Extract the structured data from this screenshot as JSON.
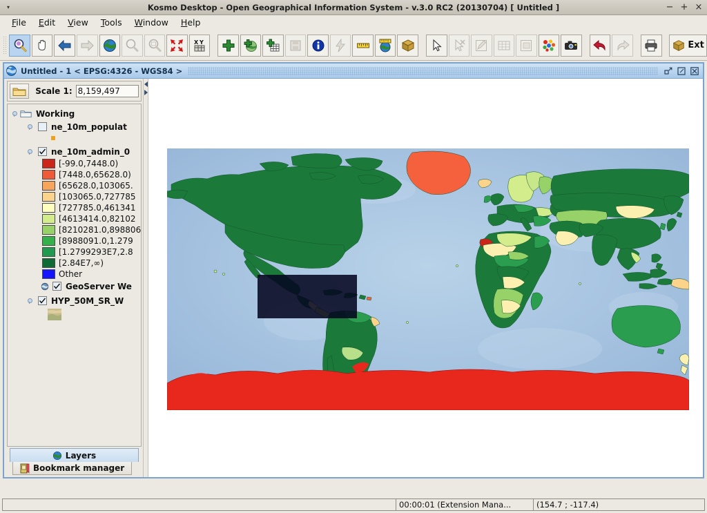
{
  "window": {
    "title": "Kosmo Desktop - Open Geographical Information System - v.3.0 RC2 (20130704)  [ Untitled ]",
    "minimize": "−",
    "maximize": "+",
    "close": "×",
    "menu_dot": "▾"
  },
  "menubar": {
    "items": [
      {
        "label": "File",
        "mnemonic": "F"
      },
      {
        "label": "Edit",
        "mnemonic": "E"
      },
      {
        "label": "View",
        "mnemonic": "V"
      },
      {
        "label": "Tools",
        "mnemonic": "T"
      },
      {
        "label": "Window",
        "mnemonic": "W"
      },
      {
        "label": "Help",
        "mnemonic": "H"
      }
    ]
  },
  "toolbar": {
    "buttons": [
      {
        "name": "zoom-in-tool-icon",
        "state": "selected"
      },
      {
        "name": "pan-hand-icon",
        "state": "normal"
      },
      {
        "name": "back-arrow-icon",
        "state": "normal"
      },
      {
        "name": "forward-arrow-icon",
        "state": "disabled"
      },
      {
        "name": "zoom-full-extent-globe-icon",
        "state": "normal"
      },
      {
        "name": "zoom-out-icon",
        "state": "disabled"
      },
      {
        "name": "zoom-selected-icon",
        "state": "disabled"
      },
      {
        "name": "zoom-to-selection-icon",
        "state": "normal"
      },
      {
        "name": "goto-xy-icon",
        "state": "normal"
      },
      {
        "name": "add-layer-icon",
        "state": "normal"
      },
      {
        "name": "add-wms-layer-icon",
        "state": "normal"
      },
      {
        "name": "add-table-layer-icon",
        "state": "normal"
      },
      {
        "name": "save-layer-icon",
        "state": "disabled"
      },
      {
        "name": "info-tool-icon",
        "state": "normal"
      },
      {
        "name": "quick-query-icon",
        "state": "disabled"
      },
      {
        "name": "measure-distance-icon",
        "state": "normal"
      },
      {
        "name": "measure-geodesic-icon",
        "state": "normal"
      },
      {
        "name": "package-3d-icon",
        "state": "normal"
      },
      {
        "name": "select-pointer-icon",
        "state": "normal"
      },
      {
        "name": "deselect-pointer-icon",
        "state": "disabled"
      },
      {
        "name": "edit-geometry-icon",
        "state": "disabled"
      },
      {
        "name": "attribute-table-icon",
        "state": "disabled"
      },
      {
        "name": "copy-layer-icon",
        "state": "disabled"
      },
      {
        "name": "symbology-icon",
        "state": "normal"
      },
      {
        "name": "snapshot-camera-icon",
        "state": "normal"
      },
      {
        "name": "undo-icon",
        "state": "normal"
      },
      {
        "name": "redo-icon",
        "state": "disabled"
      },
      {
        "name": "print-icon",
        "state": "normal"
      }
    ],
    "extension_button": {
      "label": "Ext",
      "icon": "package-3d-icon"
    }
  },
  "mapframe": {
    "title": "Untitled - 1 < EPSG:4326 - WGS84 >",
    "restore": "▫",
    "maximize": "◱",
    "close": "⌧"
  },
  "panel": {
    "folder_button_icon": "folder-icon",
    "scale_label": "Scale 1:",
    "scale_value": "8,159,497",
    "tabs": [
      {
        "label": "Layers",
        "icon": "globe-icon",
        "active": true
      },
      {
        "label": "Bookmark manager",
        "icon": "bookmark-icon",
        "active": false
      }
    ]
  },
  "tree": {
    "root": {
      "label": "Working",
      "icon": "folder-icon"
    },
    "layers": [
      {
        "label": "ne_10m_populat",
        "checked": false,
        "icon": null,
        "legend": [
          {
            "label": "",
            "color": "#f0a020",
            "shape": "dot"
          }
        ]
      },
      {
        "label": "ne_10m_admin_0",
        "checked": true,
        "icon": null,
        "legend": [
          {
            "label": "[-99.0,7448.0)",
            "color": "#cc2418"
          },
          {
            "label": "[7448.0,65628.0)",
            "color": "#ef5b38"
          },
          {
            "label": "[65628.0,103065.",
            "color": "#f8a55c"
          },
          {
            "label": "[103065.0,727785",
            "color": "#fbd38b"
          },
          {
            "label": "[727785.0,461341",
            "color": "#ffffbe"
          },
          {
            "label": "[4613414.0,82102",
            "color": "#d3ec8c"
          },
          {
            "label": "[8210281.0,898806",
            "color": "#96d268"
          },
          {
            "label": "[8988091.0,1.279",
            "color": "#34b14a"
          },
          {
            "label": "[1.2799293E7,2.8",
            "color": "#1f9a4e"
          },
          {
            "label": "[2.84E7,∞)",
            "color": "#0d6b33"
          },
          {
            "label": "Other",
            "color": "#1313ff"
          }
        ]
      },
      {
        "label": "GeoServer We",
        "checked": true,
        "icon": "wms-globe-icon",
        "legend": []
      },
      {
        "label": "HYP_50M_SR_W",
        "checked": true,
        "icon": null,
        "legend": [
          {
            "label": "",
            "color": "#c9bb8a",
            "shape": "raster"
          }
        ]
      }
    ]
  },
  "statusbar": {
    "message": "",
    "timer": "00:00:01 (Extension Mana...",
    "coordinates": "(154.7 ; -117.4)"
  },
  "map": {
    "background_color": "#a8c4e0",
    "selection_rect_color": "#040620",
    "projection": "EPSG:4326 - WGS84"
  }
}
